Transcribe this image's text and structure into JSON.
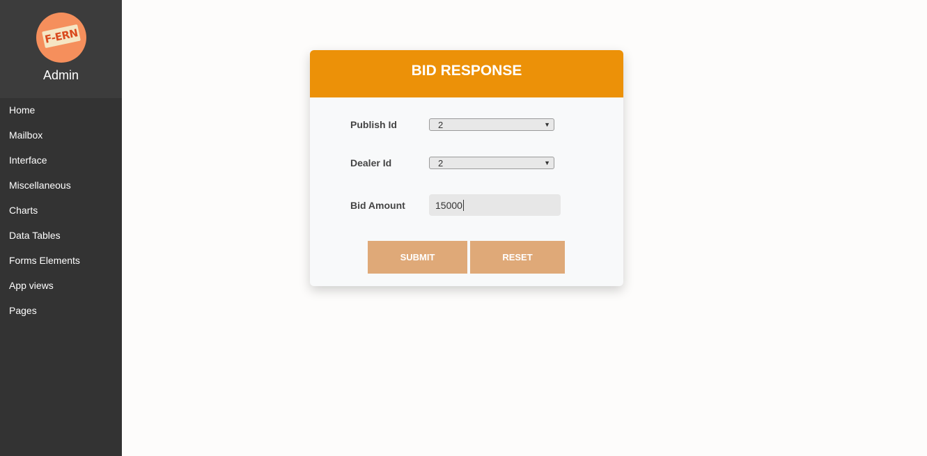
{
  "sidebar": {
    "logo_text": "F-ERN",
    "profile_name": "Admin",
    "items": [
      {
        "label": "Home"
      },
      {
        "label": "Mailbox"
      },
      {
        "label": "Interface"
      },
      {
        "label": "Miscellaneous"
      },
      {
        "label": "Charts"
      },
      {
        "label": "Data Tables"
      },
      {
        "label": "Forms Elements"
      },
      {
        "label": "App views"
      },
      {
        "label": "Pages"
      }
    ]
  },
  "form": {
    "title": "BID RESPONSE",
    "publish_id": {
      "label": "Publish Id",
      "value": "2"
    },
    "dealer_id": {
      "label": "Dealer Id",
      "value": "2"
    },
    "bid_amount": {
      "label": "Bid Amount",
      "value": "15000"
    },
    "submit_label": "SUBMIT",
    "reset_label": "RESET"
  },
  "colors": {
    "sidebar_bg": "#333333",
    "header_accent": "#ec9108",
    "button_bg": "#dfa978",
    "logo_bg": "#f58f5c"
  },
  "icons": {
    "logo": "fern-logo",
    "dropdown": "dropdown-arrow-icon"
  }
}
